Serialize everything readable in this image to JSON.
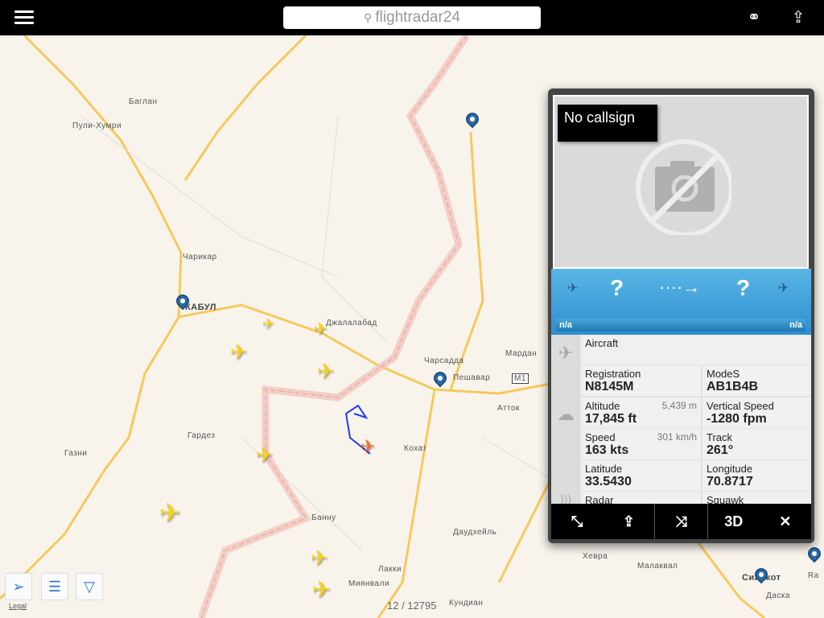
{
  "header": {
    "search_placeholder": "flightradar24",
    "menu_icon": "hamburger-icon",
    "binoculars_icon": "binoculars-icon",
    "share_icon": "share-icon"
  },
  "map": {
    "labels": [
      "Баглан",
      "Пули-Хумри",
      "Чарикар",
      "КАБУЛ",
      "Джалалабад",
      "Чарсадда",
      "Мардан",
      "Пешавар",
      "M1",
      "Атток",
      "Гардез",
      "Газни",
      "Кохат",
      "Банну",
      "Даудхейль",
      "Лакки",
      "Миянвали",
      "Кундиан",
      "Хевра",
      "Малаквал",
      "Сиалкот",
      "Даска",
      "Ra"
    ],
    "legal": "Legal",
    "aircraft_count": "12 / 12795"
  },
  "panel": {
    "callsign": "No callsign",
    "origin": "?",
    "destination": "?",
    "origin_time": "n/a",
    "destination_time": "n/a",
    "aircraft_label": "Aircraft",
    "aircraft_value": "",
    "fields": [
      {
        "label": "Registration",
        "value": "N8145M"
      },
      {
        "label": "ModeS",
        "value": "AB1B4B"
      },
      {
        "label": "Altitude",
        "value": "17,845 ft",
        "alt": "5,439 m"
      },
      {
        "label": "Vertical Speed",
        "value": "-1280 fpm"
      },
      {
        "label": "Speed",
        "value": "163 kts",
        "alt": "301 km/h"
      },
      {
        "label": "Track",
        "value": "261°"
      },
      {
        "label": "Latitude",
        "value": "33.5430"
      },
      {
        "label": "Longitude",
        "value": "70.8717"
      },
      {
        "label": "Radar",
        "value": ""
      },
      {
        "label": "Squawk",
        "value": ""
      }
    ],
    "buttons": {
      "route": "⤡",
      "share": "⇪",
      "collapse": "⤨",
      "three_d": "3D",
      "close": "✕"
    }
  },
  "colors": {
    "road": "#f7c95c",
    "border": "#f3b8b0",
    "selected_plane": "#f26a21",
    "plane": "#f3d21a",
    "panel_blue": "#3a9ad8"
  }
}
